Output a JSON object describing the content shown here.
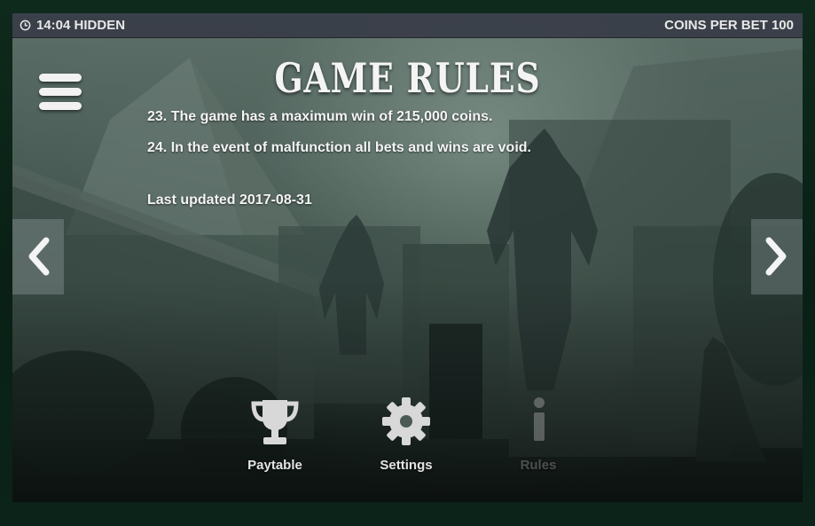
{
  "status_bar": {
    "time_mode": "14:04 HIDDEN",
    "coins_per_bet": "COINS PER BET 100"
  },
  "title": "GAME RULES",
  "rules": [
    "23. The game has a maximum win of 215,000 coins.",
    "24. In the event of malfunction all bets and wins are void."
  ],
  "last_updated": "Last updated 2017-08-31",
  "bottom_menu": [
    {
      "label": "Paytable",
      "icon": "trophy-icon"
    },
    {
      "label": "Settings",
      "icon": "gear-icon"
    },
    {
      "label": "Rules",
      "icon": "info-icon"
    }
  ]
}
